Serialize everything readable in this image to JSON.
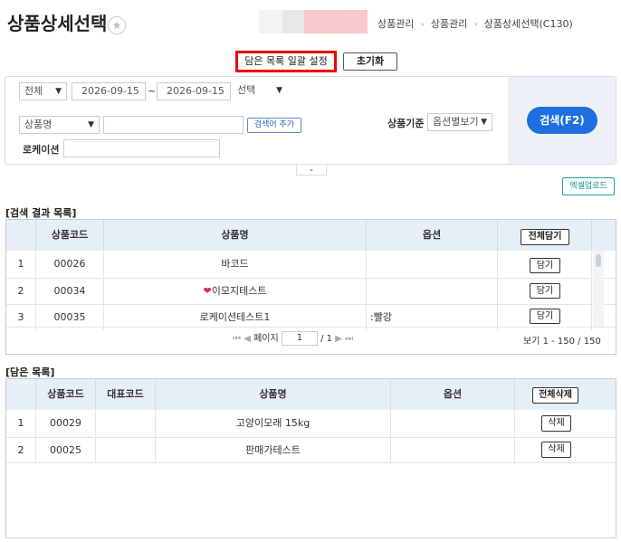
{
  "page": {
    "title": "상품상세선택",
    "star_icon": "star-icon",
    "breadcrumb": [
      "상품관리",
      "상품관리",
      "상품상세선택(C130)"
    ]
  },
  "toolbar": {
    "bulk_set_label": "담은 목록 일괄 설정",
    "reset_label": "초기화"
  },
  "search": {
    "period_select": "전체",
    "date_from": "2026-09-15",
    "date_sep": "~",
    "date_to": "2026-09-15",
    "choice_select": "선택",
    "field_select": "상품명",
    "keyword_value": "",
    "add_keyword_label": "검색어 추가",
    "location_label": "로케이션",
    "location_value": "",
    "product_basis_label": "상품기준",
    "product_basis_select": "옵션별보기",
    "search_button_label": "검색(F2)",
    "toggle_icon": "chevron-down-icon",
    "accent_color": "#1f6fe0"
  },
  "excel_upload_label": "엑셀업로드",
  "results": {
    "title": "[검색 결과 목록]",
    "columns": [
      "상품코드",
      "상품명",
      "옵션"
    ],
    "add_all_label": "전체담기",
    "add_label": "담기",
    "rows": [
      {
        "no": "1",
        "code": "00026",
        "name": "바코드",
        "option": ""
      },
      {
        "no": "2",
        "code": "00034",
        "name": "이모지테스트",
        "option": "",
        "icon": "heart-icon"
      },
      {
        "no": "3",
        "code": "00035",
        "name": "로케이션테스트1",
        "option": ":빨강"
      }
    ],
    "pager": {
      "page_label": "페이지",
      "page_value": "1",
      "total_pages": "/ 1",
      "view_info": "보기 1 - 150 / 150"
    }
  },
  "cart": {
    "title": "[담은 목록]",
    "columns": [
      "상품코드",
      "대표코드",
      "상품명",
      "옵션"
    ],
    "delete_all_label": "전체삭제",
    "delete_label": "삭제",
    "rows": [
      {
        "no": "1",
        "code": "00029",
        "rep_code": "",
        "name": "고양이모래 15kg",
        "option": ""
      },
      {
        "no": "2",
        "code": "00025",
        "rep_code": "",
        "name": "판매가테스트",
        "option": ""
      }
    ]
  }
}
